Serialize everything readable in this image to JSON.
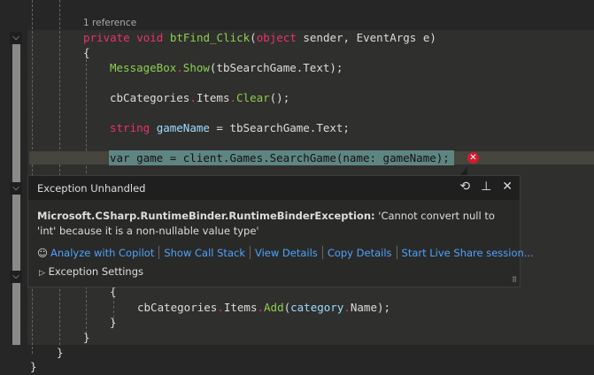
{
  "codelens": "1 reference",
  "code": {
    "l1": {
      "kw1": "private",
      "kw2": "void",
      "name": "btFind_Click",
      "p1": "(",
      "kw3": "object",
      "p2": " sender, EventArgs e)"
    },
    "l2": "{",
    "l3": {
      "cls": "MessageBox",
      "m": "Show",
      "rest": "(tbSearchGame.Text);"
    },
    "l4": {
      "a": "cbCategories",
      "b": "Items",
      "m": "Clear",
      "rest": "();"
    },
    "l5": {
      "kw": "string",
      "v": "gameName",
      "rest": " = tbSearchGame.Text;"
    },
    "l6": "var game = client.Games.SearchGame(name: gameName);",
    "l7": "{",
    "l8": {
      "a": "cbCategories",
      "b": "Items",
      "m": "Add",
      "v": "category",
      "n": "Name",
      "rest": ");"
    },
    "l9": "}",
    "l10": "}",
    "l11": "}",
    "l12": "}"
  },
  "popup": {
    "title": "Exception Unhandled",
    "exception_type": "Microsoft.CSharp.RuntimeBinder.RuntimeBinderException:",
    "message": "'Cannot convert null to 'int' because it is a non-nullable value type'",
    "links": [
      "Analyze with Copilot",
      "Show Call Stack",
      "View Details",
      "Copy Details",
      "Start Live Share session..."
    ],
    "settings": "Exception Settings"
  },
  "colors": {
    "error": "#d01c2c",
    "link": "#4da3ff",
    "keyword": "#e8336b"
  }
}
